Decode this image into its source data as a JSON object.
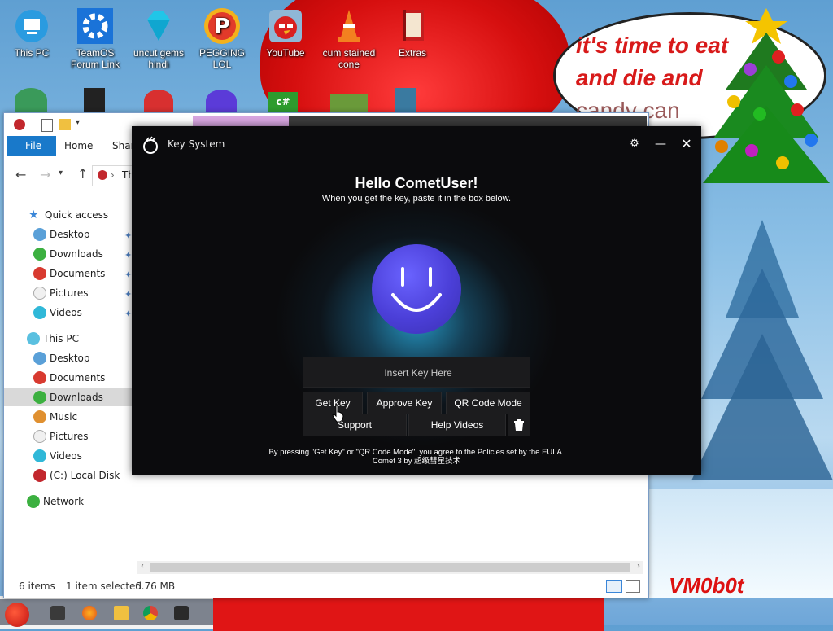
{
  "desktop": {
    "icons": [
      {
        "label": "This PC"
      },
      {
        "label": "TeamOS Forum Link"
      },
      {
        "label": "uncut gems hindi"
      },
      {
        "label": "PEGGING LOL"
      },
      {
        "label": "YouTube"
      },
      {
        "label": "cum stained cone"
      },
      {
        "label": "Extras"
      }
    ],
    "wallpaper_text": {
      "line1": "it's time to eat",
      "line2": "and die and",
      "line3": "candy can",
      "signature": "VM0b0t"
    }
  },
  "explorer": {
    "tabs": {
      "file": "File",
      "home": "Home",
      "share": "Share"
    },
    "address": "Th",
    "nav": {
      "quick_access": "Quick access",
      "quick_items": [
        "Desktop",
        "Downloads",
        "Documents",
        "Pictures",
        "Videos"
      ],
      "this_pc": "This PC",
      "pc_items": [
        "Desktop",
        "Documents",
        "Downloads",
        "Music",
        "Pictures",
        "Videos",
        "(C:) Local Disk"
      ],
      "network": "Network"
    },
    "status": {
      "items": "6 items",
      "selected": "1 item selected",
      "size": "6.76 MB"
    }
  },
  "key_system": {
    "title": "Key System",
    "greeting": "Hello CometUser!",
    "subtitle": "When you get the key, paste it in the box below.",
    "key_placeholder": "Insert Key Here",
    "buttons": {
      "get_key": "Get Key",
      "approve_key": "Approve Key",
      "qr_code_mode": "QR Code Mode",
      "support": "Support",
      "help_videos": "Help Videos"
    },
    "legal_line1": "By pressing \"Get Key\" or \"QR Code Mode\", you agree to the Policies set by the EULA.",
    "legal_line2": "Comet 3 by 超级彗星技术"
  },
  "colors": {
    "explorer_file_tab": "#1979ca",
    "ks_background": "#0b0b0d",
    "smiley": "#4b3fd8",
    "glow": "#28aadc"
  }
}
